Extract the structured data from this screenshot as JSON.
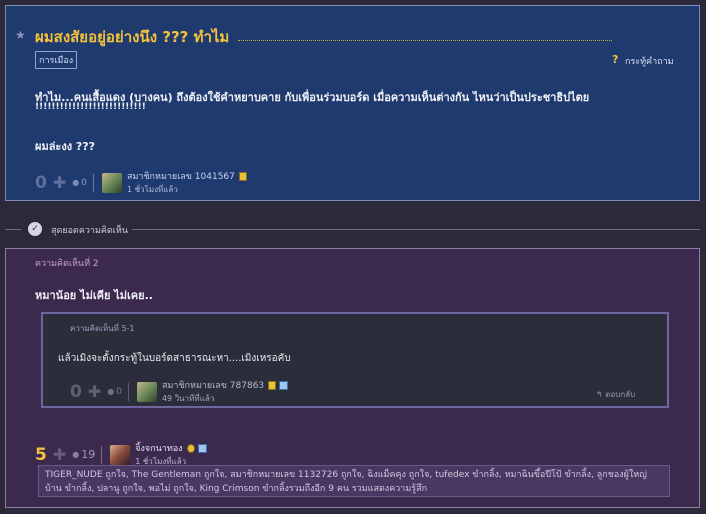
{
  "topic": {
    "title": "ผมสงสัยอยู่อย่างนึง ??? ทำไม",
    "tag": "การเมือง",
    "tag_action": "กระทู้คำถาม",
    "body_line1": "ทำไม...คนเสื้อแดง (บางคน) ถึงต้องใช้คำหยาบคาย กับเพื่อนร่วมบอร์ด    เมื่อความเห็นต่างกัน   ไหนว่าเป็นประชาธิปไตย",
    "body_line2": "!!!!!!!!!!!!!!!!!!!!!!!!!!!",
    "body_line3": "ผมล่ะงง    ???",
    "votes": "0",
    "comments": "0",
    "author": "สมาชิกหมายเลข 1041567",
    "time": "1 ชั่วโมงที่แล้ว"
  },
  "divider": {
    "label": "สุดยอดความคิดเห็น"
  },
  "comment": {
    "number": "ความคิดเห็นที่ 2",
    "text": "หมาน้อย  ไม่เคีย  ไม่เคย..",
    "votes": "5",
    "comments": "19",
    "author": "จิ้งจกนาทอง",
    "time": "1 ชั่วโมงที่แล้ว",
    "voters": "TIGER_NUDE ถูกใจ, The Gentleman ถูกใจ, สมาชิกหมายเลข 1132726 ถูกใจ, ฉิงแม็คคุง ถูกใจ, tufedex ขำกลิ้ง, หมาฉินขึ้อปีโป้ ขำกลิ้ง, ลูกชองผู้ใหญ่บ้าน ขำกลิ้ง, ปลานู ถูกใจ, พอไม่ ถูกใจ, King Crimson ขำกลิ้งรวมถึงอีก 9 คน รวมแสดงความรู้สึก"
  },
  "reply": {
    "number": "ความคิดเห็นที่ 5-1",
    "text": "แล้วเมิงจะตั้งกระทู้ในบอร์ดสาธารณะหา....เมิงเหรอคับ",
    "votes": "0",
    "comments": "0",
    "author": "สมาชิกหมายเลข 787863",
    "time": "49 วินาทีที่แล้ว",
    "reply_label": "ตอบกลับ"
  }
}
